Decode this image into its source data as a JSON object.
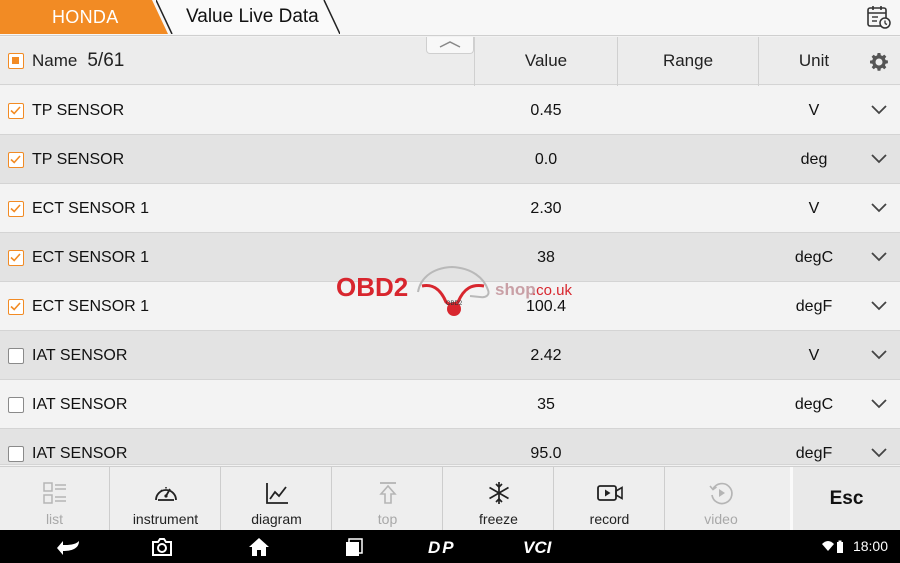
{
  "breadcrumb": {
    "brand": "HONDA",
    "page": "Value Live Data"
  },
  "table": {
    "header": {
      "name": "Name",
      "count": "5/61",
      "value": "Value",
      "range": "Range",
      "unit": "Unit"
    },
    "rows": [
      {
        "name": "TP SENSOR",
        "value": "0.45",
        "range": "",
        "unit": "V",
        "checked": true
      },
      {
        "name": "TP SENSOR",
        "value": "0.0",
        "range": "",
        "unit": "deg",
        "checked": true
      },
      {
        "name": "ECT SENSOR 1",
        "value": "2.30",
        "range": "",
        "unit": "V",
        "checked": true
      },
      {
        "name": "ECT SENSOR 1",
        "value": "38",
        "range": "",
        "unit": "degC",
        "checked": true
      },
      {
        "name": "ECT SENSOR 1",
        "value": "100.4",
        "range": "",
        "unit": "degF",
        "checked": true
      },
      {
        "name": "IAT SENSOR",
        "value": "2.42",
        "range": "",
        "unit": "V",
        "checked": false
      },
      {
        "name": "IAT SENSOR",
        "value": "35",
        "range": "",
        "unit": "degC",
        "checked": false
      },
      {
        "name": "IAT SENSOR",
        "value": "95.0",
        "range": "",
        "unit": "degF",
        "checked": false
      }
    ]
  },
  "watermark": {
    "brand": "OBD2",
    "shop": "shop",
    "domain": ".co.uk",
    "badge": "OBD2"
  },
  "toolbar": {
    "buttons": [
      {
        "label": "list",
        "icon": "list-icon",
        "enabled": false
      },
      {
        "label": "instrument",
        "icon": "gauge-icon",
        "enabled": true
      },
      {
        "label": "diagram",
        "icon": "line-chart-icon",
        "enabled": true
      },
      {
        "label": "top",
        "icon": "move-to-top-icon",
        "enabled": false
      },
      {
        "label": "freeze",
        "icon": "snowflake-icon",
        "enabled": true
      },
      {
        "label": "record",
        "icon": "video-camera-icon",
        "enabled": true
      },
      {
        "label": "video",
        "icon": "replay-icon",
        "enabled": false
      }
    ],
    "esc": "Esc"
  },
  "statusbar": {
    "logo1": "DP",
    "logo2": "VCI",
    "time": "18:00"
  },
  "colors": {
    "accent": "#f28b24",
    "watermark_red": "#d8262e"
  }
}
